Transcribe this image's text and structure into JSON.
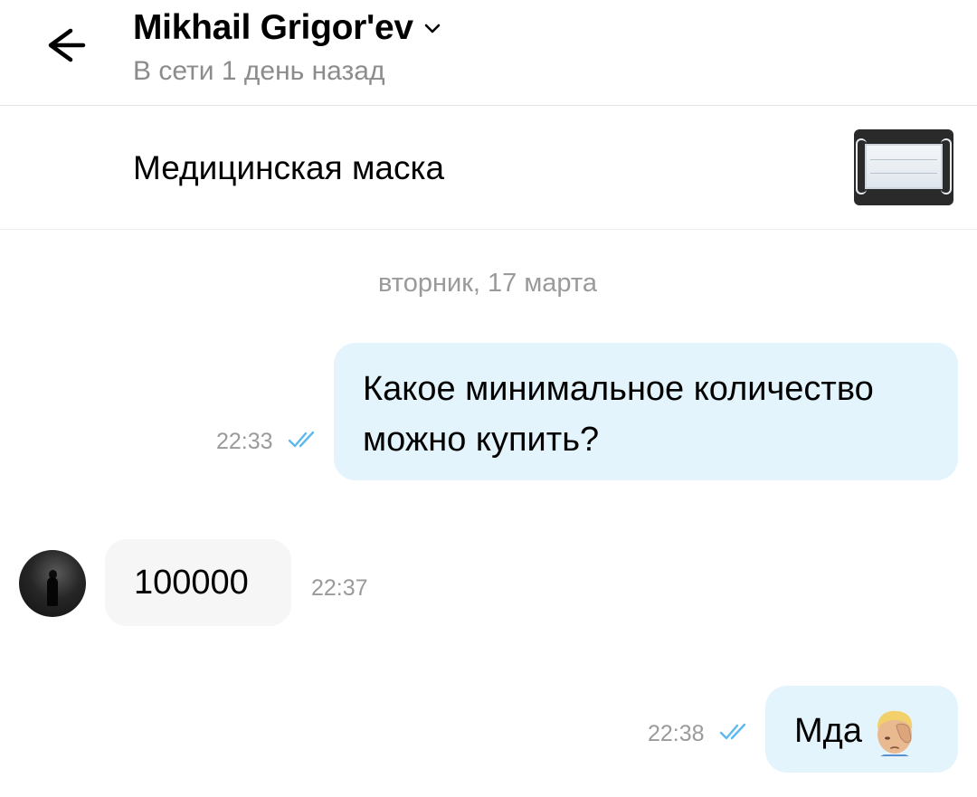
{
  "header": {
    "contact_name": "Mikhail Grigor'ev",
    "status": "В сети 1 день назад",
    "icons": {
      "back": "arrow-left-icon",
      "expand": "chevron-down-icon"
    }
  },
  "item": {
    "title": "Медицинская маска",
    "thumbnail": "medical-mask-photo"
  },
  "chat": {
    "date_divider": "вторник, 17 марта",
    "messages": [
      {
        "direction": "outgoing",
        "text_line1": "Какое минимальное количество",
        "text_line2": "можно купить?",
        "time": "22:33",
        "status": "read"
      },
      {
        "direction": "incoming",
        "text": "100000",
        "time": "22:37"
      },
      {
        "direction": "outgoing",
        "text": "Мда",
        "emoji": "man-facepalming-emoji",
        "time": "22:38",
        "status": "read"
      }
    ]
  },
  "colors": {
    "outgoing_bubble": "#e3f4fd",
    "incoming_bubble": "#f6f6f6",
    "read_check": "#5db8f0",
    "secondary_text": "#8c8c8c"
  }
}
